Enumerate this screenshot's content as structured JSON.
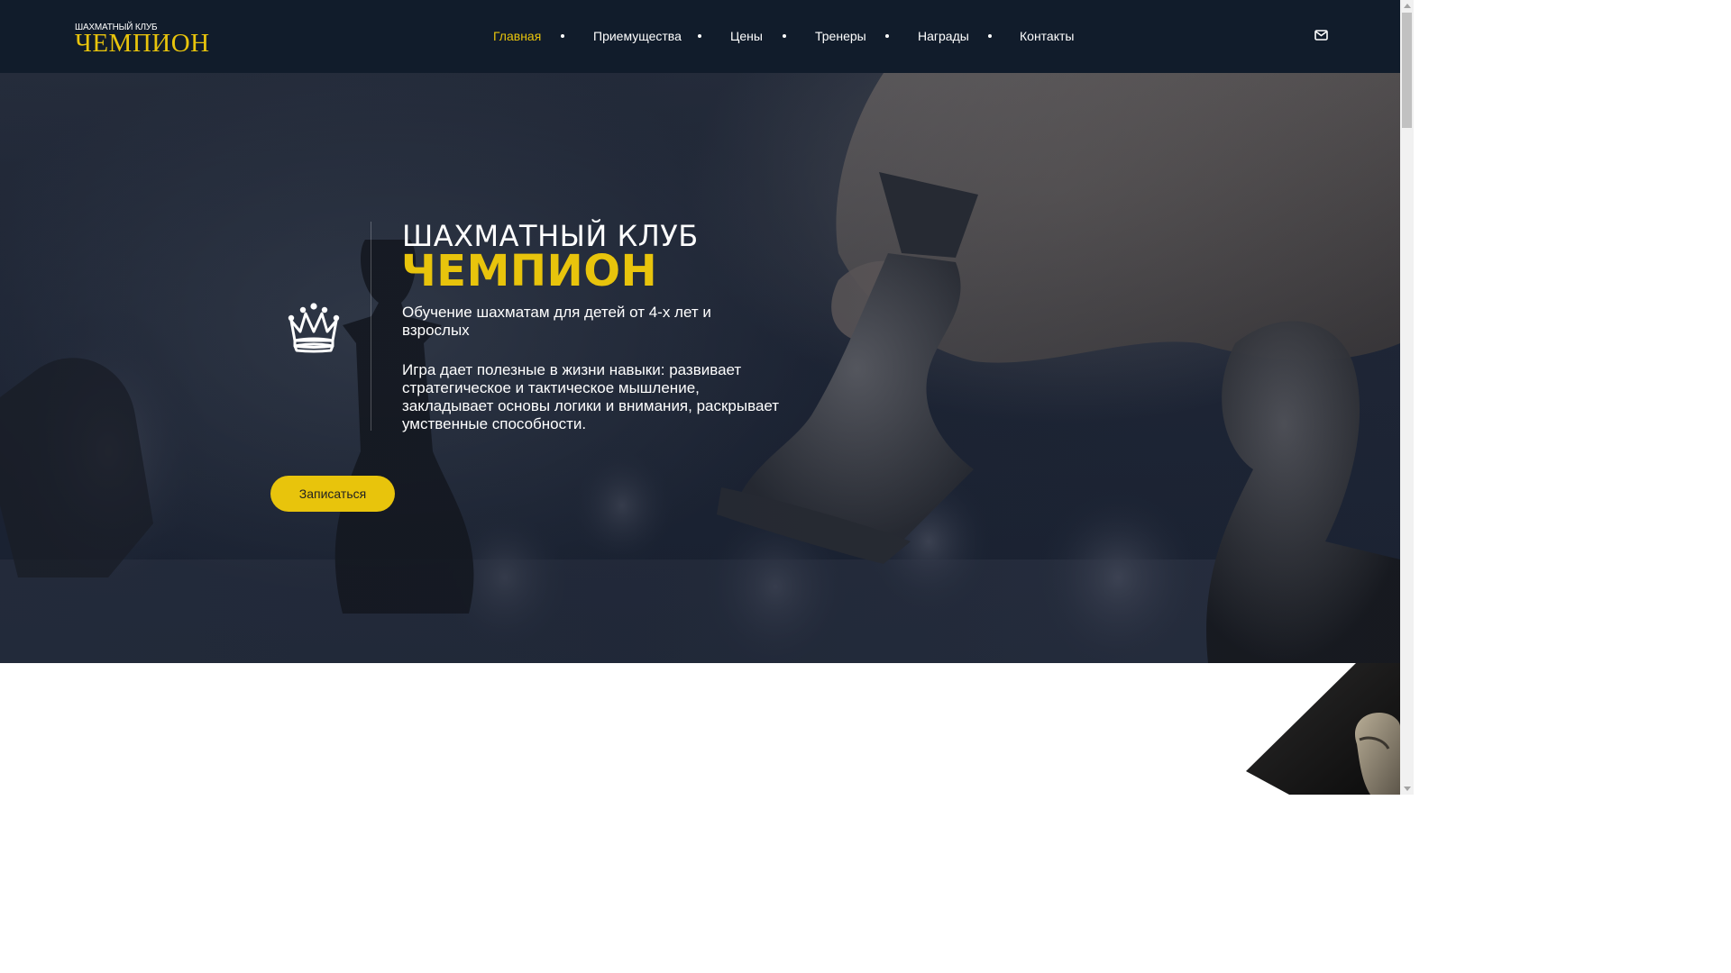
{
  "logo": {
    "small": "ШАХМАТНЫЙ КЛУБ",
    "big": "ЧЕМПИОН"
  },
  "nav": {
    "items": [
      {
        "label": "Главная",
        "active": true
      },
      {
        "label": "Приемущества",
        "active": false
      },
      {
        "label": "Цены",
        "active": false
      },
      {
        "label": "Тренеры",
        "active": false
      },
      {
        "label": "Награды",
        "active": false
      },
      {
        "label": "Контакты",
        "active": false
      }
    ],
    "mail_icon": "envelope-icon"
  },
  "hero": {
    "title_small": "ШАХМАТНЫЙ КЛУБ",
    "title_big": "ЧЕМПИОН",
    "subtitle": "Обучение шахматам для детей от 4-х лет и взрослых",
    "description": "Игра дает полезные в жизни навыки: развивает стратегическое и тактическое мышление, закладывает основы логики и внимания, раскрывает умственные способности.",
    "cta_label": "Записаться",
    "icon": "crown-icon"
  },
  "colors": {
    "accent": "#e8c40c",
    "header_bg": "#111c2b",
    "hero_bg": "#1f2636",
    "text": "#ffffff"
  }
}
